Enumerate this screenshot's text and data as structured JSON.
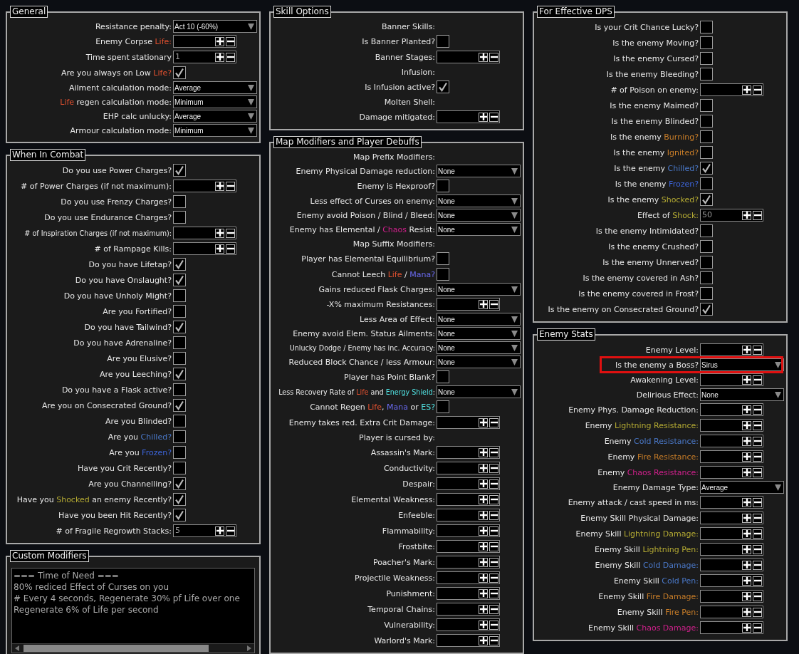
{
  "columns": [
    {
      "panels": [
        {
          "title": "General",
          "kind": "options",
          "rows": [
            {
              "kind": "select",
              "label": "Resistance penalty:",
              "value": "Act 10 (-60%)"
            },
            {
              "kind": "number",
              "label_parts": [
                {
                  "text": "Enemy Corpse "
                },
                {
                  "text": "Life:",
                  "color": "#e0502f"
                }
              ]
            },
            {
              "kind": "number",
              "label": "Time spent stationary",
              "value": "1"
            },
            {
              "kind": "check",
              "label_parts": [
                {
                  "text": "Are you always on Low "
                },
                {
                  "text": "Life?",
                  "color": "#e0502f"
                }
              ],
              "checked": true
            },
            {
              "kind": "select",
              "label": "Ailment calculation mode:",
              "value": "Average"
            },
            {
              "kind": "select",
              "label_parts": [
                {
                  "text": "Life",
                  "color": "#e0502f"
                },
                {
                  "text": " regen calculation mode:"
                }
              ],
              "value": "Minimum"
            },
            {
              "kind": "select",
              "label": "EHP calc unlucky:",
              "value": "Average"
            },
            {
              "kind": "select",
              "label": "Armour calculation mode:",
              "value": "Minimum"
            }
          ]
        },
        {
          "title": "When In Combat",
          "kind": "options",
          "rows": [
            {
              "kind": "check",
              "label": "Do you use Power Charges?",
              "checked": true
            },
            {
              "kind": "number",
              "label": "# of Power Charges (if not maximum):"
            },
            {
              "kind": "check",
              "label": "Do you use Frenzy Charges?",
              "checked": false
            },
            {
              "kind": "check",
              "label": "Do you use Endurance Charges?",
              "checked": false
            },
            {
              "kind": "number",
              "label": "# of Inspiration Charges (if not maximum):"
            },
            {
              "kind": "number",
              "label": "# of Rampage Kills:"
            },
            {
              "kind": "check",
              "label": "Do you have Lifetap?",
              "checked": true
            },
            {
              "kind": "check",
              "label": "Do you have Onslaught?",
              "checked": true
            },
            {
              "kind": "check",
              "label": "Do you have Unholy Might?",
              "checked": false
            },
            {
              "kind": "check",
              "label": "Are you Fortified?",
              "checked": false
            },
            {
              "kind": "check",
              "label": "Do you have Tailwind?",
              "checked": true
            },
            {
              "kind": "check",
              "label": "Do you have Adrenaline?",
              "checked": false
            },
            {
              "kind": "check",
              "label": "Are you Elusive?",
              "checked": false
            },
            {
              "kind": "check",
              "label": "Are you Leeching?",
              "checked": true
            },
            {
              "kind": "check",
              "label": "Do you have a Flask active?",
              "checked": false
            },
            {
              "kind": "check",
              "label": "Are you on Consecrated Ground?",
              "checked": true
            },
            {
              "kind": "check",
              "label": "Are you Blinded?",
              "checked": false
            },
            {
              "kind": "check",
              "label_parts": [
                {
                  "text": "Are you "
                },
                {
                  "text": "Chilled?",
                  "color": "#4a78c8"
                }
              ],
              "checked": false
            },
            {
              "kind": "check",
              "label_parts": [
                {
                  "text": "Are you "
                },
                {
                  "text": "Frozen?",
                  "color": "#3c64d8"
                }
              ],
              "checked": false
            },
            {
              "kind": "check",
              "label": "Have you Crit Recently?",
              "checked": false
            },
            {
              "kind": "check",
              "label": "Are you Channelling?",
              "checked": true
            },
            {
              "kind": "check",
              "label_parts": [
                {
                  "text": "Have you "
                },
                {
                  "text": "Shocked",
                  "color": "#b5ab33"
                },
                {
                  "text": " an enemy Recently?"
                }
              ],
              "checked": true
            },
            {
              "kind": "check",
              "label": "Have you been Hit Recently?",
              "checked": true
            },
            {
              "kind": "number",
              "label": "# of Fragile Regrowth Stacks:",
              "value": "5"
            }
          ]
        },
        {
          "title": "Custom Modifiers",
          "kind": "text",
          "lines": [
            "=== Time of Need ===",
            "80% rediced Effect of Curses on you",
            "# Every 4 seconds, Regenerate 30% pf Life over one",
            "Regenerate 6% of Life per second"
          ]
        }
      ]
    },
    {
      "panels": [
        {
          "title": "Skill Options",
          "kind": "options",
          "rows": [
            {
              "kind": "header",
              "label": "Banner Skills:"
            },
            {
              "kind": "check",
              "label": "Is Banner Planted?",
              "checked": false
            },
            {
              "kind": "number",
              "label": "Banner Stages:"
            },
            {
              "kind": "header",
              "label": "Infusion:"
            },
            {
              "kind": "check",
              "label": "Is Infusion active?",
              "checked": true
            },
            {
              "kind": "header",
              "label": "Molten Shell:"
            },
            {
              "kind": "number",
              "label": "Damage mitigated:"
            }
          ]
        },
        {
          "title": "Map Modifiers and Player Debuffs",
          "kind": "options",
          "rows": [
            {
              "kind": "header",
              "label": "Map Prefix Modifiers:"
            },
            {
              "kind": "select",
              "label": "Enemy Physical Damage reduction:",
              "value": "None"
            },
            {
              "kind": "check",
              "label": "Enemy is Hexproof?",
              "checked": false
            },
            {
              "kind": "select",
              "label": "Less effect of Curses on enemy:",
              "value": "None"
            },
            {
              "kind": "select",
              "label": "Enemy avoid Poison / Blind / Bleed:",
              "value": "None"
            },
            {
              "kind": "select",
              "label_parts": [
                {
                  "text": "Enemy has Elemental / "
                },
                {
                  "text": "Chaos",
                  "color": "#d0208c"
                },
                {
                  "text": " Resist:"
                }
              ],
              "value": "None"
            },
            {
              "kind": "header",
              "label": "Map Suffix Modifiers:"
            },
            {
              "kind": "check",
              "label": "Player has Elemental Equilibrium?",
              "checked": false
            },
            {
              "kind": "check",
              "label_parts": [
                {
                  "text": "Cannot Leech "
                },
                {
                  "text": "Life",
                  "color": "#e0502f"
                },
                {
                  "text": " / "
                },
                {
                  "text": "Mana?",
                  "color": "#6a6af0"
                }
              ],
              "checked": false
            },
            {
              "kind": "select",
              "label": "Gains reduced Flask Charges:",
              "value": "None"
            },
            {
              "kind": "number",
              "label": "-X% maximum Resistances:"
            },
            {
              "kind": "select",
              "label": "Less Area of Effect:",
              "value": "None"
            },
            {
              "kind": "select",
              "label": "Enemy avoid Elem. Status Ailments:",
              "value": "None"
            },
            {
              "kind": "select",
              "label": "Unlucky Dodge / Enemy has inc. Accuracy:",
              "value": "None"
            },
            {
              "kind": "select",
              "label": "Reduced Block Chance / less Armour:",
              "value": "None"
            },
            {
              "kind": "check",
              "label": "Player has Point Blank?",
              "checked": false
            },
            {
              "kind": "select",
              "label_parts": [
                {
                  "text": "Less Recovery Rate of "
                },
                {
                  "text": "Life",
                  "color": "#e0502f"
                },
                {
                  "text": " and "
                },
                {
                  "text": "Energy Shield",
                  "color": "#50e0e0"
                },
                {
                  "text": ":"
                }
              ],
              "value": "None"
            },
            {
              "kind": "check",
              "label_parts": [
                {
                  "text": "Cannot Regen "
                },
                {
                  "text": "Life",
                  "color": "#e0502f"
                },
                {
                  "text": ", "
                },
                {
                  "text": "Mana",
                  "color": "#6a6af0"
                },
                {
                  "text": " or "
                },
                {
                  "text": "ES?",
                  "color": "#50e0e0"
                }
              ],
              "checked": false
            },
            {
              "kind": "number",
              "label": "Enemy takes red. Extra Crit Damage:"
            },
            {
              "kind": "header",
              "label": "Player is cursed by:"
            },
            {
              "kind": "number",
              "label": "Assassin's Mark:"
            },
            {
              "kind": "number",
              "label": "Conductivity:"
            },
            {
              "kind": "number",
              "label": "Despair:"
            },
            {
              "kind": "number",
              "label": "Elemental Weakness:"
            },
            {
              "kind": "number",
              "label": "Enfeeble:"
            },
            {
              "kind": "number",
              "label": "Flammability:"
            },
            {
              "kind": "number",
              "label": "Frostbite:"
            },
            {
              "kind": "number",
              "label": "Poacher's Mark:"
            },
            {
              "kind": "number",
              "label": "Projectile Weakness:"
            },
            {
              "kind": "number",
              "label": "Punishment:"
            },
            {
              "kind": "number",
              "label": "Temporal Chains:"
            },
            {
              "kind": "number",
              "label": "Vulnerability:"
            },
            {
              "kind": "number",
              "label": "Warlord's Mark:"
            }
          ]
        }
      ]
    },
    {
      "panels": [
        {
          "title": "For Effective DPS",
          "kind": "options",
          "rows": [
            {
              "kind": "check",
              "label": "Is your Crit Chance Lucky?",
              "checked": false
            },
            {
              "kind": "check",
              "label": "Is the enemy Moving?",
              "checked": false
            },
            {
              "kind": "check",
              "label": "Is the enemy Cursed?",
              "checked": false
            },
            {
              "kind": "check",
              "label": "Is the enemy Bleeding?",
              "checked": false
            },
            {
              "kind": "number",
              "label": "# of Poison on enemy:"
            },
            {
              "kind": "check",
              "label": "Is the enemy Maimed?",
              "checked": false
            },
            {
              "kind": "check",
              "label": "Is the enemy Blinded?",
              "checked": false
            },
            {
              "kind": "check",
              "label_parts": [
                {
                  "text": "Is the enemy "
                },
                {
                  "text": "Burning?",
                  "color": "#c87d28"
                }
              ],
              "checked": false
            },
            {
              "kind": "check",
              "label_parts": [
                {
                  "text": "Is the enemy "
                },
                {
                  "text": "Ignited?",
                  "color": "#c87d28"
                }
              ],
              "checked": false
            },
            {
              "kind": "check",
              "label_parts": [
                {
                  "text": "Is the enemy "
                },
                {
                  "text": "Chilled?",
                  "color": "#4a78c8"
                }
              ],
              "checked": true
            },
            {
              "kind": "check",
              "label_parts": [
                {
                  "text": "Is the enemy "
                },
                {
                  "text": "Frozen?",
                  "color": "#3c64d8"
                }
              ],
              "checked": false
            },
            {
              "kind": "check",
              "label_parts": [
                {
                  "text": "Is the enemy "
                },
                {
                  "text": "Shocked?",
                  "color": "#b5ab33"
                }
              ],
              "checked": true
            },
            {
              "kind": "number",
              "label_parts": [
                {
                  "text": "Effect of "
                },
                {
                  "text": "Shock:",
                  "color": "#b5ab33"
                }
              ],
              "value": "50"
            },
            {
              "kind": "check",
              "label": "Is the enemy Intimidated?",
              "checked": false
            },
            {
              "kind": "check",
              "label": "Is the enemy Crushed?",
              "checked": false
            },
            {
              "kind": "check",
              "label": "Is the enemy Unnerved?",
              "checked": false
            },
            {
              "kind": "check",
              "label": "Is the enemy covered in Ash?",
              "checked": false
            },
            {
              "kind": "check",
              "label": "Is the enemy covered in Frost?",
              "checked": false
            },
            {
              "kind": "check",
              "label": "Is the enemy on Consecrated Ground?",
              "checked": true
            }
          ]
        },
        {
          "title": "Enemy Stats",
          "kind": "options",
          "rows": [
            {
              "kind": "number",
              "label": "Enemy Level:"
            },
            {
              "kind": "select",
              "label": "Is the enemy a Boss?",
              "value": "Sirus",
              "highlighted": true
            },
            {
              "kind": "number",
              "label": "Awakening Level:"
            },
            {
              "kind": "select",
              "label": "Delirious Effect:",
              "value": "None"
            },
            {
              "kind": "number",
              "label": "Enemy Phys. Damage Reduction:"
            },
            {
              "kind": "number",
              "label_parts": [
                {
                  "text": "Enemy "
                },
                {
                  "text": "Lightning Resistance:",
                  "color": "#b5ab33"
                }
              ]
            },
            {
              "kind": "number",
              "label_parts": [
                {
                  "text": "Enemy "
                },
                {
                  "text": "Cold Resistance:",
                  "color": "#4a78c8"
                }
              ]
            },
            {
              "kind": "number",
              "label_parts": [
                {
                  "text": "Enemy "
                },
                {
                  "text": "Fire Resistance:",
                  "color": "#c87d28"
                }
              ]
            },
            {
              "kind": "number",
              "label_parts": [
                {
                  "text": "Enemy "
                },
                {
                  "text": "Chaos Resistance:",
                  "color": "#d0208c"
                }
              ]
            },
            {
              "kind": "select",
              "label": "Enemy Damage Type:",
              "value": "Average"
            },
            {
              "kind": "number",
              "label": "Enemy attack / cast speed in ms:"
            },
            {
              "kind": "number",
              "label": "Enemy Skill Physical Damage:"
            },
            {
              "kind": "number",
              "label_parts": [
                {
                  "text": "Enemy Skill "
                },
                {
                  "text": "Lightning Damage:",
                  "color": "#b5ab33"
                }
              ]
            },
            {
              "kind": "number",
              "label_parts": [
                {
                  "text": "Enemy Skill "
                },
                {
                  "text": "Lightning Pen:",
                  "color": "#b5ab33"
                }
              ]
            },
            {
              "kind": "number",
              "label_parts": [
                {
                  "text": "Enemy Skill "
                },
                {
                  "text": "Cold Damage:",
                  "color": "#4a78c8"
                }
              ]
            },
            {
              "kind": "number",
              "label_parts": [
                {
                  "text": "Enemy Skill "
                },
                {
                  "text": "Cold Pen:",
                  "color": "#4a78c8"
                }
              ]
            },
            {
              "kind": "number",
              "label_parts": [
                {
                  "text": "Enemy Skill "
                },
                {
                  "text": "Fire Damage:",
                  "color": "#c87d28"
                }
              ]
            },
            {
              "kind": "number",
              "label_parts": [
                {
                  "text": "Enemy Skill "
                },
                {
                  "text": "Fire Pen:",
                  "color": "#c87d28"
                }
              ]
            },
            {
              "kind": "number",
              "label_parts": [
                {
                  "text": "Enemy Skill "
                },
                {
                  "text": "Chaos Damage:",
                  "color": "#d0208c"
                }
              ]
            }
          ]
        }
      ]
    }
  ]
}
